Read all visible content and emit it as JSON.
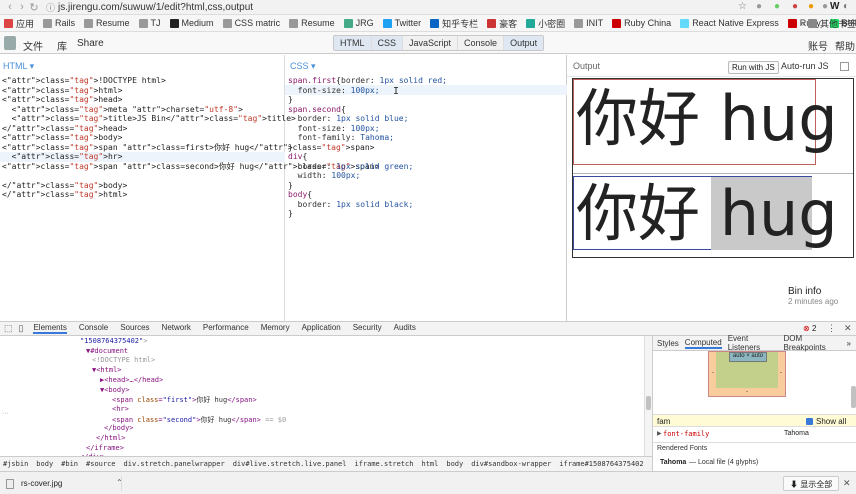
{
  "browser": {
    "url": "js.jirengu.com/suwuw/1/edit?html,css,output",
    "right_icons": [
      "☆",
      "●",
      "●",
      "●",
      "●",
      "●",
      "W",
      "◐"
    ]
  },
  "bookmarks": {
    "items": [
      {
        "label": "应用",
        "color": "#d44"
      },
      {
        "label": "Rails",
        "color": "#999"
      },
      {
        "label": "Resume",
        "color": "#999"
      },
      {
        "label": "TJ",
        "color": "#999"
      },
      {
        "label": "Medium",
        "color": "#222"
      },
      {
        "label": "CSS matric",
        "color": "#999"
      },
      {
        "label": "Resume",
        "color": "#999"
      },
      {
        "label": "JRG",
        "color": "#4a8"
      },
      {
        "label": "Twitter",
        "color": "#1da1f2"
      },
      {
        "label": "知乎专栏",
        "color": "#0a66c2"
      },
      {
        "label": "豪客",
        "color": "#c33"
      },
      {
        "label": "小密圈",
        "color": "#2a9"
      },
      {
        "label": "INIT",
        "color": "#999"
      },
      {
        "label": "Ruby China",
        "color": "#c00"
      },
      {
        "label": "React Native Express",
        "color": "#61dafb"
      },
      {
        "label": "Ruby",
        "color": "#c00"
      },
      {
        "label": "BuiltWith",
        "color": "#2d6"
      }
    ],
    "more": "»",
    "other": "其他书签"
  },
  "toolbar": {
    "file": "文件",
    "library": "库",
    "share": "Share",
    "tabs": [
      {
        "label": "HTML",
        "active": true
      },
      {
        "label": "CSS",
        "active": true
      },
      {
        "label": "JavaScript",
        "active": false
      },
      {
        "label": "Console",
        "active": false
      },
      {
        "label": "Output",
        "active": true
      }
    ],
    "account": "账号",
    "help": "帮助"
  },
  "html_panel": {
    "label": "HTML ▾",
    "lines": [
      "<!DOCTYPE html>",
      "<html>",
      "<head>",
      "  <meta charset=\"utf-8\">",
      "  <title>JS Bin</title>",
      "</head>",
      "<body>",
      "<span class=first>你好 hug</span>",
      "  <hr>",
      "<span class=second>你好 hug</span>",
      "",
      "</body>",
      "</html>"
    ]
  },
  "css_panel": {
    "label": "CSS ▾",
    "lines": [
      "span.first{border: 1px solid red;",
      "  font-size: 100px;",
      "}",
      "span.second{",
      "  border: 1px solid blue;",
      "  font-size: 100px;",
      "  font-family: Tahoma;",
      "}",
      "div{",
      "  border: 1px solid green;",
      "  width: 100px;",
      "}",
      "body{",
      "  border: 1px solid black;",
      "}"
    ],
    "cursor": "I"
  },
  "output_panel": {
    "label": "Output",
    "run_button": "Run with JS",
    "autorun": "Auto-run JS",
    "span1_text": "你好 hug",
    "span2_cjk": "你好 ",
    "span2_latin": "hug",
    "bin_info_title": "Bin info",
    "bin_info_sub": "2 minutes ago"
  },
  "devtools": {
    "tabs": [
      {
        "label": "Elements",
        "active": true
      },
      {
        "label": "Console",
        "active": false
      },
      {
        "label": "Sources",
        "active": false
      },
      {
        "label": "Network",
        "active": false
      },
      {
        "label": "Performance",
        "active": false
      },
      {
        "label": "Memory",
        "active": false
      },
      {
        "label": "Application",
        "active": false
      },
      {
        "label": "Security",
        "active": false
      },
      {
        "label": "Audits",
        "active": false
      }
    ],
    "error_count": "2",
    "elements": [
      {
        "indent": 80,
        "html": "<span class='v'>\"1508764375402\"</span><span class='g'>&gt;</span>"
      },
      {
        "indent": 86,
        "html": "▼#document"
      },
      {
        "indent": 92,
        "html": "<span class='g'>&lt;!DOCTYPE html&gt;</span>"
      },
      {
        "indent": 92,
        "html": "▼&lt;html&gt;"
      },
      {
        "indent": 100,
        "html": "▶&lt;head&gt;…&lt;/head&gt;"
      },
      {
        "indent": 100,
        "html": "▼&lt;body&gt;"
      },
      {
        "indent": 112,
        "html": "&lt;span <span class='a'>class</span>=<span class='v'>\"first\"</span>&gt;<span class='t'>你好 hug</span>&lt;/span&gt;"
      },
      {
        "indent": 112,
        "html": "&lt;hr&gt;"
      },
      {
        "indent": 112,
        "html": "&lt;span <span class='a'>class</span>=<span class='v'>\"second\"</span>&gt;<span class='t'>你好 hug</span>&lt;/span&gt; <span class='g'>== $0</span>"
      },
      {
        "indent": 104,
        "html": "&lt;/body&gt;"
      },
      {
        "indent": 96,
        "html": "&lt;/html&gt;"
      },
      {
        "indent": 86,
        "html": "&lt;/iframe&gt;"
      },
      {
        "indent": 80,
        "html": "&lt;/div&gt;"
      }
    ],
    "right_tabs": [
      {
        "label": "Styles",
        "active": false
      },
      {
        "label": "Computed",
        "active": true
      },
      {
        "label": "Event Listeners",
        "active": false
      },
      {
        "label": "DOM Breakpoints",
        "active": false
      },
      {
        "label": "»",
        "active": false
      }
    ],
    "box_auto": "auto × auto",
    "filter": "fam",
    "show_all": "Show all",
    "prop_name": "font-family",
    "prop_value": "Tahoma",
    "rendered_fonts": "Rendered Fonts",
    "font_name": "Tahoma",
    "font_source": "—  Local file (4 glyphs)",
    "breadcrumbs": [
      {
        "label": "#jsbin",
        "sel": false
      },
      {
        "label": "body",
        "sel": false
      },
      {
        "label": "#bin",
        "sel": false
      },
      {
        "label": "#source",
        "sel": false
      },
      {
        "label": "div.stretch.panelwrapper",
        "sel": false
      },
      {
        "label": "div#live.stretch.live.panel",
        "sel": false
      },
      {
        "label": "iframe.stretch",
        "sel": false
      },
      {
        "label": "html",
        "sel": false
      },
      {
        "label": "body",
        "sel": false
      },
      {
        "label": "div#sandbox-wrapper",
        "sel": false
      },
      {
        "label": "iframe#1508764375402",
        "sel": false
      },
      {
        "label": "html",
        "sel": false
      },
      {
        "label": "body",
        "sel": false
      },
      {
        "label": "span.second",
        "sel": true
      }
    ]
  },
  "downloads": {
    "file": "rs-cover.jpg",
    "show_all": "显示全部",
    "close": "✕"
  }
}
